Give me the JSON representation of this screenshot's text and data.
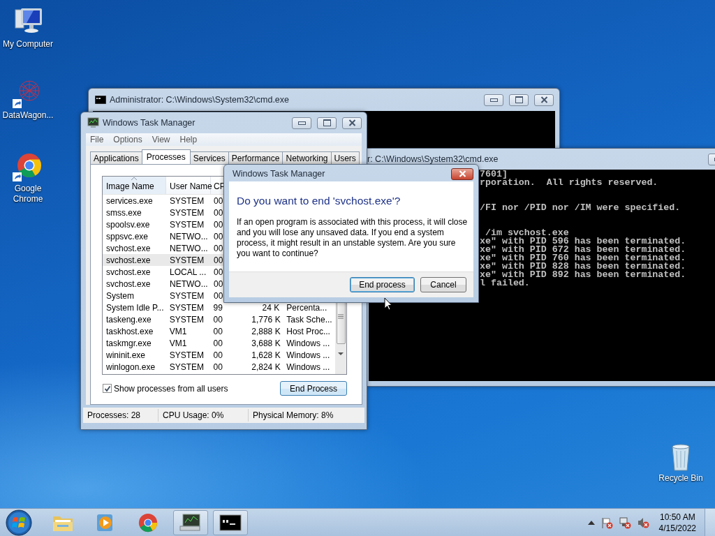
{
  "desktop_icons": [
    {
      "label": "My Computer",
      "kind": "computer",
      "shortcut": false
    },
    {
      "label": "DataWagon...",
      "kind": "web",
      "shortcut": true
    },
    {
      "label": "Google Chrome",
      "kind": "chrome",
      "shortcut": true
    },
    {
      "label": "Recycle Bin",
      "kind": "recycle",
      "shortcut": false
    }
  ],
  "cmd_window_back": {
    "title": "Administrator: C:\\Windows\\System32\\cmd.exe"
  },
  "cmd_window_front": {
    "title": "r: C:\\Windows\\System32\\cmd.exe",
    "console": [
      [
        "7601]",
        "rporation.  All rights reserved."
      ],
      [
        "/FI nor /PID nor /IM were specified."
      ],
      [
        " /im svchost.exe",
        "xe\" with PID 596 has been terminated.",
        "xe\" with PID 672 has been terminated.",
        "xe\" with PID 760 has been terminated.",
        "xe\" with PID 828 has been terminated.",
        "xe\" with PID 892 has been terminated.",
        "l failed."
      ]
    ]
  },
  "task_manager": {
    "title": "Windows Task Manager",
    "menu": [
      "File",
      "Options",
      "View",
      "Help"
    ],
    "tabs": [
      {
        "label": "Applications",
        "selected": false
      },
      {
        "label": "Processes",
        "selected": true
      },
      {
        "label": "Services",
        "selected": false
      },
      {
        "label": "Performance",
        "selected": false
      },
      {
        "label": "Networking",
        "selected": false
      },
      {
        "label": "Users",
        "selected": false
      }
    ],
    "columns": [
      {
        "label": "Image Name",
        "sorted": true
      },
      {
        "label": "User Name",
        "sorted": false
      },
      {
        "label": "CP",
        "sorted": false
      }
    ],
    "rows": [
      {
        "image": "services.exe",
        "user": "SYSTEM",
        "cpu": "00",
        "selected": false
      },
      {
        "image": "smss.exe",
        "user": "SYSTEM",
        "cpu": "00",
        "selected": false
      },
      {
        "image": "spoolsv.exe",
        "user": "SYSTEM",
        "cpu": "00",
        "selected": false
      },
      {
        "image": "sppsvc.exe",
        "user": "NETWO...",
        "cpu": "00",
        "selected": false
      },
      {
        "image": "svchost.exe",
        "user": "NETWO...",
        "cpu": "00",
        "selected": false
      },
      {
        "image": "svchost.exe",
        "user": "SYSTEM",
        "cpu": "00",
        "selected": true
      },
      {
        "image": "svchost.exe",
        "user": "LOCAL ...",
        "cpu": "00",
        "selected": false
      },
      {
        "image": "svchost.exe",
        "user": "NETWO...",
        "cpu": "00",
        "selected": false
      },
      {
        "image": "System",
        "user": "SYSTEM",
        "cpu": "00",
        "selected": false
      },
      {
        "image": "System Idle P...",
        "user": "SYSTEM",
        "cpu": "99",
        "memory": "24 K",
        "description": "Percenta...",
        "selected": false
      },
      {
        "image": "taskeng.exe",
        "user": "SYSTEM",
        "cpu": "00",
        "memory": "1,776 K",
        "description": "Task Sche...",
        "selected": false
      },
      {
        "image": "taskhost.exe",
        "user": "VM1",
        "cpu": "00",
        "memory": "2,888 K",
        "description": "Host Proc...",
        "selected": false
      },
      {
        "image": "taskmgr.exe",
        "user": "VM1",
        "cpu": "00",
        "memory": "3,688 K",
        "description": "Windows ...",
        "selected": false
      },
      {
        "image": "wininit.exe",
        "user": "SYSTEM",
        "cpu": "00",
        "memory": "1,628 K",
        "description": "Windows ...",
        "selected": false
      },
      {
        "image": "winlogon.exe",
        "user": "SYSTEM",
        "cpu": "00",
        "memory": "2,824 K",
        "description": "Windows ...",
        "selected": false
      }
    ],
    "show_all_users": {
      "label": "Show processes from all users",
      "checked": true
    },
    "end_button": "End Process",
    "status": [
      "Processes: 28",
      "CPU Usage: 0%",
      "Physical Memory: 8%"
    ]
  },
  "dialog": {
    "title": "Windows Task Manager",
    "heading": "Do you want to end 'svchost.exe'?",
    "message": "If an open program is associated with this process, it will close and you will lose any unsaved data. If you end a system process, it might result in an unstable system. Are you sure you want to continue?",
    "buttons": [
      {
        "label": "End process",
        "default": true
      },
      {
        "label": "Cancel",
        "default": false
      }
    ]
  },
  "taskbar": {
    "apps": [
      {
        "kind": "folder",
        "active": false
      },
      {
        "kind": "media",
        "active": false
      },
      {
        "kind": "chrome",
        "active": false
      },
      {
        "kind": "taskmgr",
        "active": true
      },
      {
        "kind": "cmd",
        "active": true
      }
    ],
    "time": "10:50 AM",
    "date": "4/15/2022"
  }
}
